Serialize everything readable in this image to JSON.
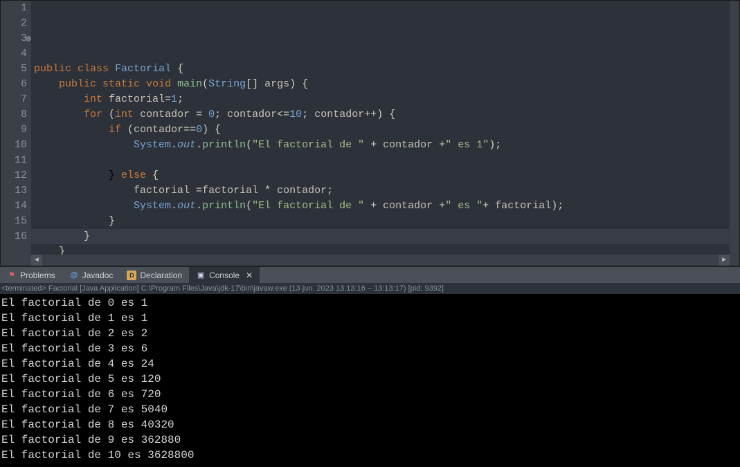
{
  "editor": {
    "line_count": 16,
    "breakpoint_line": 3,
    "current_line": 16,
    "tokens": {
      "l2": [
        [
          "",
          ""
        ],
        [
          "public",
          "kw"
        ],
        [
          " ",
          "txt"
        ],
        [
          "class",
          "kw"
        ],
        [
          " ",
          "txt"
        ],
        [
          "Factorial",
          "cls"
        ],
        [
          " {",
          "pun"
        ]
      ],
      "l3": [
        [
          "    ",
          ""
        ],
        [
          "public",
          "kw"
        ],
        [
          " ",
          "txt"
        ],
        [
          "static",
          "kw"
        ],
        [
          " ",
          "txt"
        ],
        [
          "void",
          "kw"
        ],
        [
          " ",
          "txt"
        ],
        [
          "main",
          "mth"
        ],
        [
          "(",
          "pun"
        ],
        [
          "String",
          "type"
        ],
        [
          "[] ",
          "pun"
        ],
        [
          "args",
          "var"
        ],
        [
          ") {",
          "pun"
        ]
      ],
      "l4": [
        [
          "        ",
          ""
        ],
        [
          "int",
          "kw"
        ],
        [
          " ",
          "txt"
        ],
        [
          "factorial",
          "var"
        ],
        [
          "=",
          "pun"
        ],
        [
          "1",
          "num"
        ],
        [
          ";",
          "pun"
        ]
      ],
      "l5": [
        [
          "        ",
          ""
        ],
        [
          "for",
          "kw"
        ],
        [
          " (",
          "pun"
        ],
        [
          "int",
          "kw"
        ],
        [
          " ",
          "txt"
        ],
        [
          "contador",
          "var"
        ],
        [
          " = ",
          "pun"
        ],
        [
          "0",
          "num"
        ],
        [
          "; ",
          "pun"
        ],
        [
          "contador",
          "var"
        ],
        [
          "<=",
          "pun"
        ],
        [
          "10",
          "num"
        ],
        [
          "; ",
          "pun"
        ],
        [
          "contador",
          "var"
        ],
        [
          "++) {",
          "pun"
        ]
      ],
      "l6": [
        [
          "            ",
          ""
        ],
        [
          "if",
          "kw"
        ],
        [
          " (",
          "pun"
        ],
        [
          "contador",
          "var"
        ],
        [
          "==",
          "pun"
        ],
        [
          "0",
          "num"
        ],
        [
          ") {",
          "pun"
        ]
      ],
      "l7": [
        [
          "                ",
          ""
        ],
        [
          "System",
          "obj"
        ],
        [
          ".",
          "pun"
        ],
        [
          "out",
          "fld"
        ],
        [
          ".",
          "pun"
        ],
        [
          "println",
          "mth"
        ],
        [
          "(",
          "pun"
        ],
        [
          "\"El factorial de \"",
          "str"
        ],
        [
          " + ",
          "pun"
        ],
        [
          "contador",
          "var"
        ],
        [
          " +",
          "pun"
        ],
        [
          "\" es 1\"",
          "str"
        ],
        [
          ");",
          "pun"
        ]
      ],
      "l8": [
        [
          "",
          ""
        ]
      ],
      "l9": [
        [
          "            } ",
          ""
        ],
        [
          "else",
          "kw"
        ],
        [
          " {",
          "pun"
        ]
      ],
      "l10": [
        [
          "                ",
          ""
        ],
        [
          "factorial",
          "var"
        ],
        [
          " =",
          "pun"
        ],
        [
          "factorial",
          "var"
        ],
        [
          " * ",
          "pun"
        ],
        [
          "contador",
          "var"
        ],
        [
          ";",
          "pun"
        ]
      ],
      "l11": [
        [
          "                ",
          ""
        ],
        [
          "System",
          "obj"
        ],
        [
          ".",
          "pun"
        ],
        [
          "out",
          "fld"
        ],
        [
          ".",
          "pun"
        ],
        [
          "println",
          "mth"
        ],
        [
          "(",
          "pun"
        ],
        [
          "\"El factorial de \"",
          "str"
        ],
        [
          " + ",
          "pun"
        ],
        [
          "contador",
          "var"
        ],
        [
          " +",
          "pun"
        ],
        [
          "\" es \"",
          "str"
        ],
        [
          "+ ",
          "pun"
        ],
        [
          "factorial",
          "var"
        ],
        [
          ");",
          "pun"
        ]
      ],
      "l12": [
        [
          "            }",
          "pun"
        ]
      ],
      "l13": [
        [
          "        }",
          "pun"
        ]
      ],
      "l14": [
        [
          "    }",
          "pun"
        ]
      ],
      "l15": [
        [
          "}",
          "pun"
        ]
      ]
    }
  },
  "tabs": {
    "problems": "Problems",
    "javadoc": "Javadoc",
    "declaration": "Declaration",
    "console": "Console"
  },
  "run_status": "<terminated> Factorial [Java Application] C:\\Program Files\\Java\\jdk-17\\bin\\javaw.exe  (13 jun. 2023 13:13:16 – 13:13:17) [pid: 9392]",
  "console_output": [
    "El factorial de 0 es 1",
    "El factorial de 1 es 1",
    "El factorial de 2 es 2",
    "El factorial de 3 es 6",
    "El factorial de 4 es 24",
    "El factorial de 5 es 120",
    "El factorial de 6 es 720",
    "El factorial de 7 es 5040",
    "El factorial de 8 es 40320",
    "El factorial de 9 es 362880",
    "El factorial de 10 es 3628800"
  ]
}
